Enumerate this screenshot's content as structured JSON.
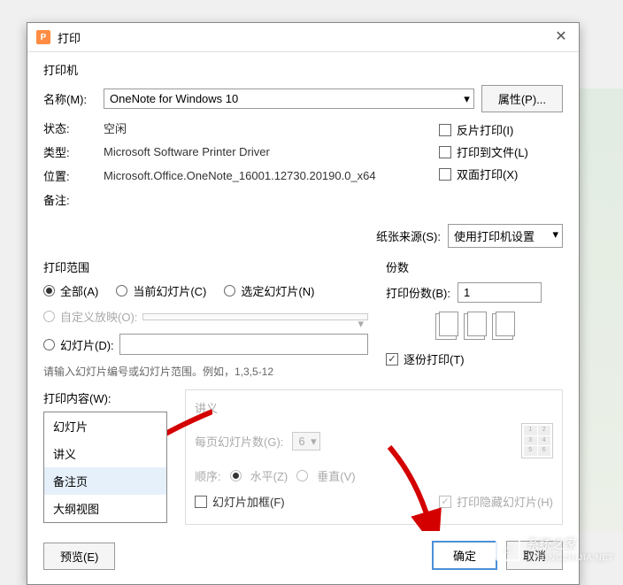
{
  "dialog": {
    "title": "打印",
    "printer_section": "打印机",
    "name_label": "名称(M):",
    "printer_name": "OneNote for Windows 10",
    "properties_btn": "属性(P)...",
    "status_label": "状态:",
    "status_value": "空闲",
    "type_label": "类型:",
    "type_value": "Microsoft Software Printer Driver",
    "location_label": "位置:",
    "location_value": "Microsoft.Office.OneNote_16001.12730.20190.0_x64",
    "note_label": "备注:",
    "reverse_print": "反片打印(I)",
    "print_to_file": "打印到文件(L)",
    "duplex": "双面打印(X)",
    "source_label": "纸张来源(S):",
    "source_value": "使用打印机设置"
  },
  "range": {
    "title": "打印范围",
    "all": "全部(A)",
    "current": "当前幻灯片(C)",
    "selected": "选定幻灯片(N)",
    "custom": "自定义放映(O):",
    "slides": "幻灯片(D):",
    "hint": "请输入幻灯片编号或幻灯片范围。例如，1,3,5-12"
  },
  "copies": {
    "title": "份数",
    "count_label": "打印份数(B):",
    "count_value": "1",
    "collate": "逐份打印(T)"
  },
  "content": {
    "label": "打印内容(W):",
    "selected": "幻灯片",
    "options": [
      "幻灯片",
      "讲义",
      "备注页",
      "大纲视图"
    ]
  },
  "handout": {
    "title": "讲义",
    "per_page_label": "每页幻灯片数(G):",
    "per_page_value": "6",
    "order_label": "顺序:",
    "horizontal": "水平(Z)",
    "vertical": "垂直(V)",
    "frame": "幻灯片加框(F)",
    "hidden": "打印隐藏幻灯片(H)"
  },
  "footer": {
    "preview": "预览(E)",
    "ok": "确定",
    "cancel": "取消"
  },
  "watermark": {
    "name": "系统之家",
    "url": "XITONGZHIJIA.NET"
  }
}
